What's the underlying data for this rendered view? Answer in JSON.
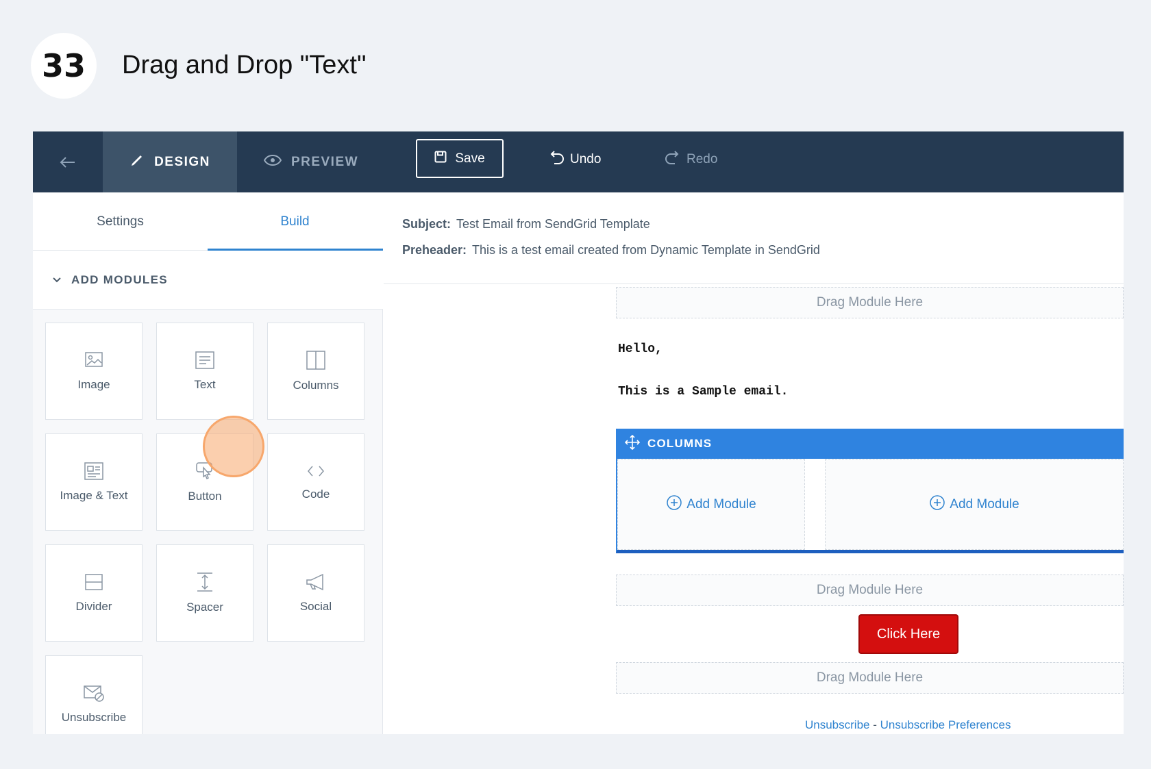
{
  "step": {
    "number": "33",
    "title": "Drag and Drop \"Text\""
  },
  "toolbar": {
    "back_icon": "arrow-left-icon",
    "design_label": "DESIGN",
    "preview_label": "PREVIEW",
    "save_label": "Save",
    "undo_label": "Undo",
    "redo_label": "Redo"
  },
  "sidebar": {
    "tabs": [
      {
        "label": "Settings",
        "active": false
      },
      {
        "label": "Build",
        "active": true
      }
    ],
    "section_title": "ADD MODULES",
    "modules": [
      {
        "label": "Image",
        "icon": "image-icon"
      },
      {
        "label": "Text",
        "icon": "text-icon"
      },
      {
        "label": "Columns",
        "icon": "columns-icon"
      },
      {
        "label": "Image & Text",
        "icon": "image-text-icon"
      },
      {
        "label": "Button",
        "icon": "button-click-icon"
      },
      {
        "label": "Code",
        "icon": "code-icon"
      },
      {
        "label": "Divider",
        "icon": "divider-icon"
      },
      {
        "label": "Spacer",
        "icon": "spacer-icon"
      },
      {
        "label": "Social",
        "icon": "megaphone-icon"
      },
      {
        "label": "Unsubscribe",
        "icon": "unsubscribe-icon"
      }
    ]
  },
  "email": {
    "subject_label": "Subject:",
    "subject": "Test Email from SendGrid Template",
    "preheader_label": "Preheader:",
    "preheader": "This is a test email created from Dynamic Template in SendGrid",
    "drag_module_here": "Drag Module Here",
    "greeting": "Hello,",
    "body_text": "This is a Sample email.",
    "columns_label": "COLUMNS",
    "add_module_label": "Add Module",
    "button_label": "Click Here",
    "footer": {
      "unsubscribe": "Unsubscribe",
      "separator": "-",
      "preferences": "Unsubscribe Preferences"
    }
  },
  "colors": {
    "toolbar_bg": "#253a52",
    "active_tab": "#2f83cf",
    "columns_header": "#2f83e0",
    "cta_button": "#d40f0f",
    "drag_highlight": "#f7a76c"
  }
}
